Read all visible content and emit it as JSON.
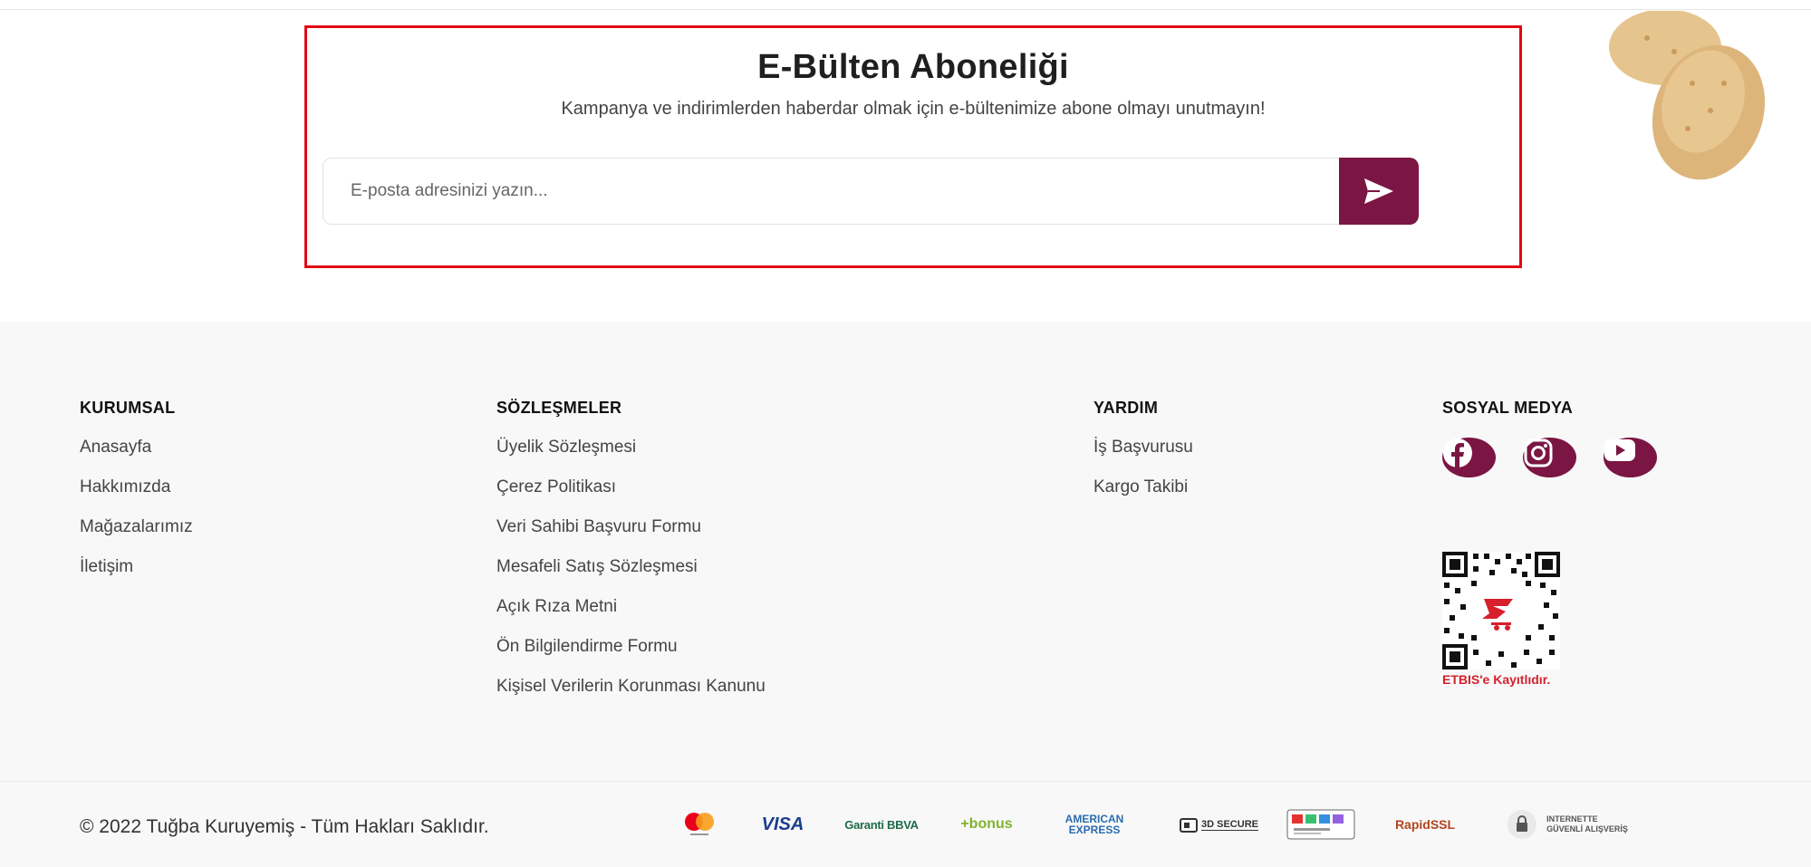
{
  "newsletter": {
    "title": "E-Bülten Aboneliği",
    "subtitle": "Kampanya ve indirimlerden haberdar olmak için e-bültenimize abone olmayı unutmayın!",
    "email_placeholder": "E-posta adresinizi yazın...",
    "submit_icon": "send-icon"
  },
  "colors": {
    "accent": "#7b1543",
    "highlight_border": "#e30613",
    "footer_bg": "#f8f8f8"
  },
  "footer": {
    "kurumsal": {
      "heading": "KURUMSAL",
      "links": [
        "Anasayfa",
        "Hakkımızda",
        "Mağazalarımız",
        "İletişim"
      ]
    },
    "sozlesmeler": {
      "heading": "SÖZLEŞMELER",
      "links": [
        "Üyelik Sözleşmesi",
        "Çerez Politikası",
        "Veri Sahibi Başvuru Formu",
        "Mesafeli Satış Sözleşmesi",
        "Açık Rıza Metni",
        "Ön Bilgilendirme Formu",
        "Kişisel Verilerin Korunması Kanunu"
      ]
    },
    "yardim": {
      "heading": "YARDIM",
      "links": [
        "İş Başvurusu",
        "Kargo Takibi"
      ]
    },
    "sosyal": {
      "heading": "SOSYAL MEDYA",
      "icons": [
        "facebook-icon",
        "instagram-icon",
        "youtube-icon"
      ]
    },
    "etbis_label": "ETBIS'e Kayıtlıdır."
  },
  "bottom": {
    "copyright": "© 2022 Tuğba Kuruyemiş - Tüm Hakları Saklıdır.",
    "payment_logos": {
      "visa": "VISA",
      "garanti": "Garanti BBVA",
      "bonus": "+bonus",
      "amex_1": "AMERICAN",
      "amex_2": "EXPRESS",
      "secure": "3D SECURE",
      "rapidssl": "RapidSSL",
      "guvenli_1": "INTERNETTE",
      "guvenli_2": "GÜVENLİ ALIŞVERİŞ"
    }
  }
}
